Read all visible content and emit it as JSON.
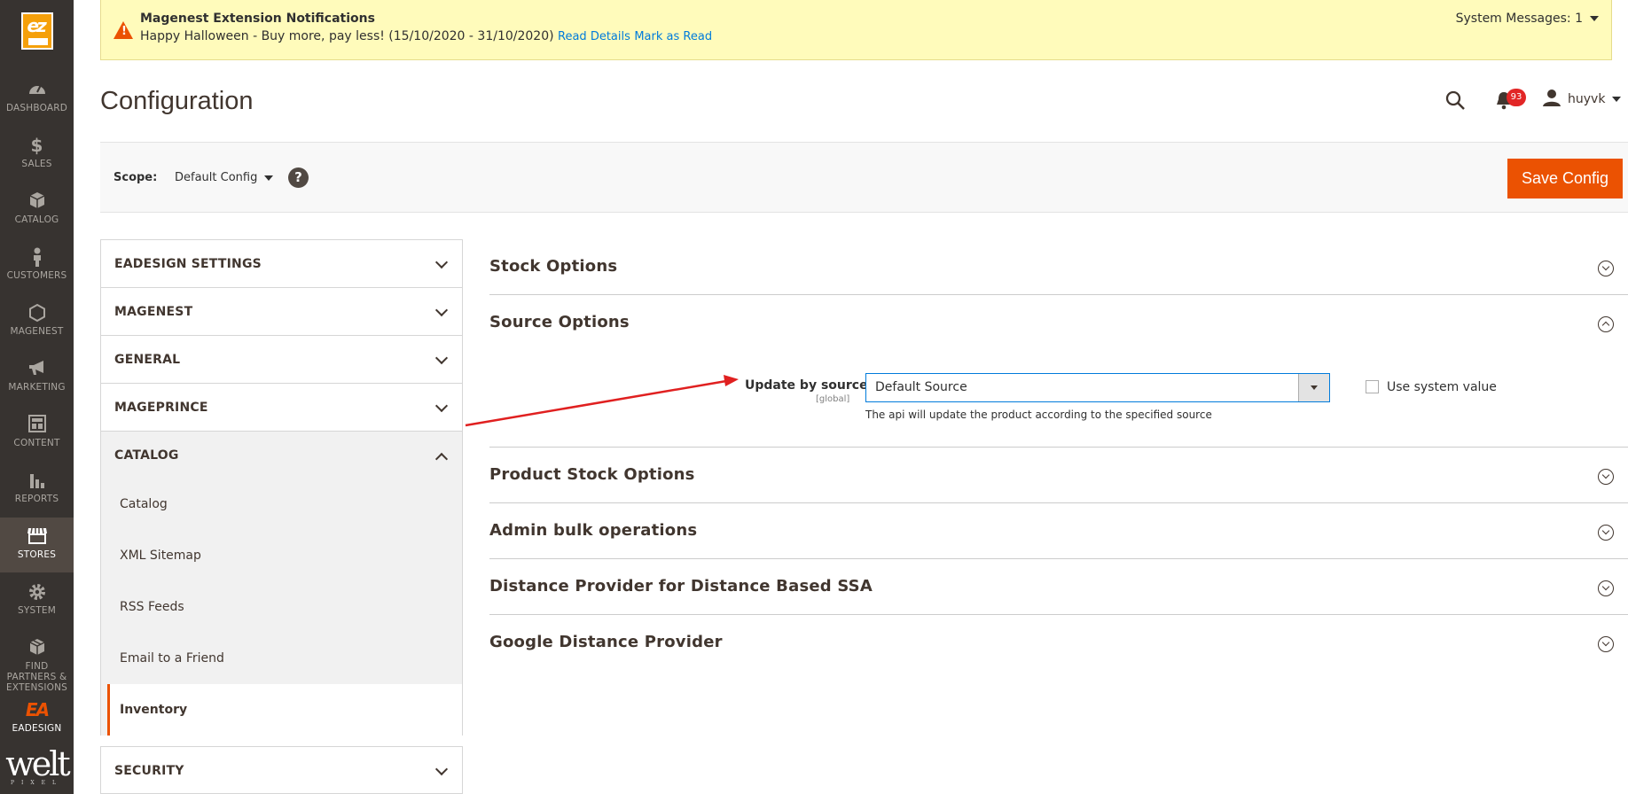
{
  "menu": {
    "logo": "ez",
    "items": [
      {
        "label": "DASHBOARD",
        "icon": "dashboard-icon"
      },
      {
        "label": "SALES",
        "icon": "dollar-icon"
      },
      {
        "label": "CATALOG",
        "icon": "box-icon"
      },
      {
        "label": "CUSTOMERS",
        "icon": "person-icon"
      },
      {
        "label": "MAGENEST",
        "icon": "hexagon-icon"
      },
      {
        "label": "MARKETING",
        "icon": "megaphone-icon"
      },
      {
        "label": "CONTENT",
        "icon": "layout-icon"
      },
      {
        "label": "REPORTS",
        "icon": "bar-chart-icon"
      },
      {
        "label": "STORES",
        "icon": "store-icon"
      },
      {
        "label": "SYSTEM",
        "icon": "gear-icon"
      },
      {
        "label": "FIND PARTNERS & EXTENSIONS",
        "icon": "puzzle-box-icon"
      },
      {
        "label": "EADESIGN",
        "icon": "ea-logo-icon"
      }
    ],
    "welt": "welt",
    "welt_sub": "PIXEL"
  },
  "notice": {
    "title": "Magenest Extension Notifications",
    "text": "Happy Halloween - Buy more, pay less! (15/10/2020 - 31/10/2020)",
    "read_details": "Read Details",
    "mark_read": "Mark as Read",
    "system_messages": "System Messages: 1"
  },
  "header": {
    "title": "Configuration",
    "notifications_count": "93",
    "user": "huyvk"
  },
  "scope": {
    "label": "Scope:",
    "value": "Default Config",
    "help": "?",
    "save": "Save Config"
  },
  "tabs": {
    "groups": [
      "EADESIGN SETTINGS",
      "MAGENEST",
      "GENERAL",
      "MAGEPRINCE",
      "CATALOG"
    ],
    "catalog_items": [
      "Catalog",
      "XML Sitemap",
      "RSS Feeds",
      "Email to a Friend",
      "Inventory"
    ],
    "security": "SECURITY"
  },
  "sections": {
    "titles": [
      "Stock Options",
      "Source Options",
      "Product Stock Options",
      "Admin bulk operations",
      "Distance Provider for Distance Based SSA",
      "Google Distance Provider"
    ]
  },
  "field": {
    "label": "Update by source",
    "scope": "[global]",
    "value": "Default Source",
    "hint": "The api will update the product according to the specified source",
    "use_system": "Use system value"
  },
  "colors": {
    "accent": "#eb5202",
    "sidebar": "#373330",
    "notice_bg": "#fffbbb",
    "arrow": "#e02020"
  }
}
